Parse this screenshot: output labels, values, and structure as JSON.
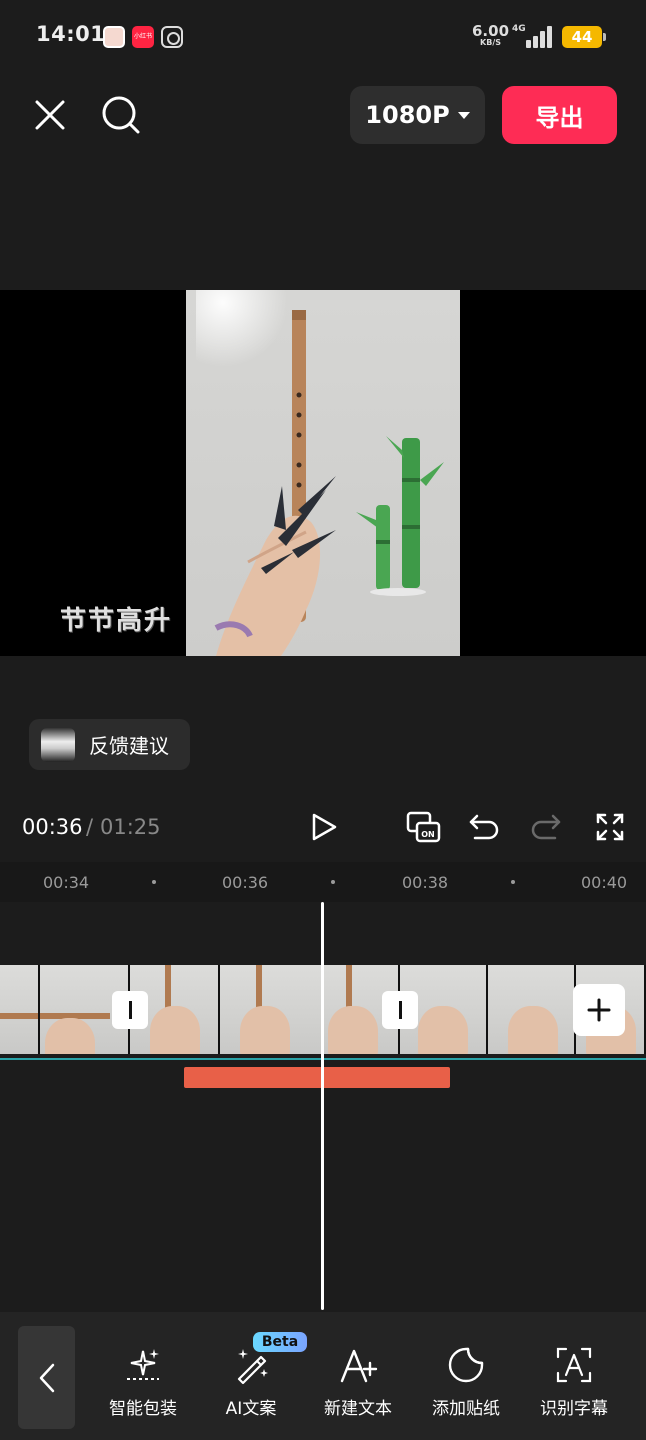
{
  "status_bar": {
    "time": "14:01",
    "net_speed": "6.00",
    "net_unit": "KB/S",
    "network": "4G",
    "battery": "44",
    "app_xhs_label": "小红书"
  },
  "toolbar": {
    "resolution": "1080P",
    "export_label": "导出"
  },
  "preview": {
    "watermark_text": "节节高升"
  },
  "feedback": {
    "label": "反馈建议"
  },
  "playback": {
    "current_time": "00:36",
    "separator": "/",
    "total_time": "01:25"
  },
  "ruler": {
    "ticks": [
      "00:34",
      "00:36",
      "00:38",
      "00:40"
    ]
  },
  "bottom_tools": [
    {
      "label": "智能包装",
      "icon": "sparkle-icon"
    },
    {
      "label": "AI文案",
      "icon": "magic-wand-icon",
      "badge": "Beta"
    },
    {
      "label": "新建文本",
      "icon": "text-add-icon"
    },
    {
      "label": "添加贴纸",
      "icon": "sticker-icon"
    },
    {
      "label": "识别字幕",
      "icon": "caption-recognize-icon"
    }
  ],
  "colors": {
    "export_button": "#fe2c55",
    "text_track": "#e86048",
    "track_line": "#2aa3a8",
    "beta_badge": "#6ad8ff"
  }
}
